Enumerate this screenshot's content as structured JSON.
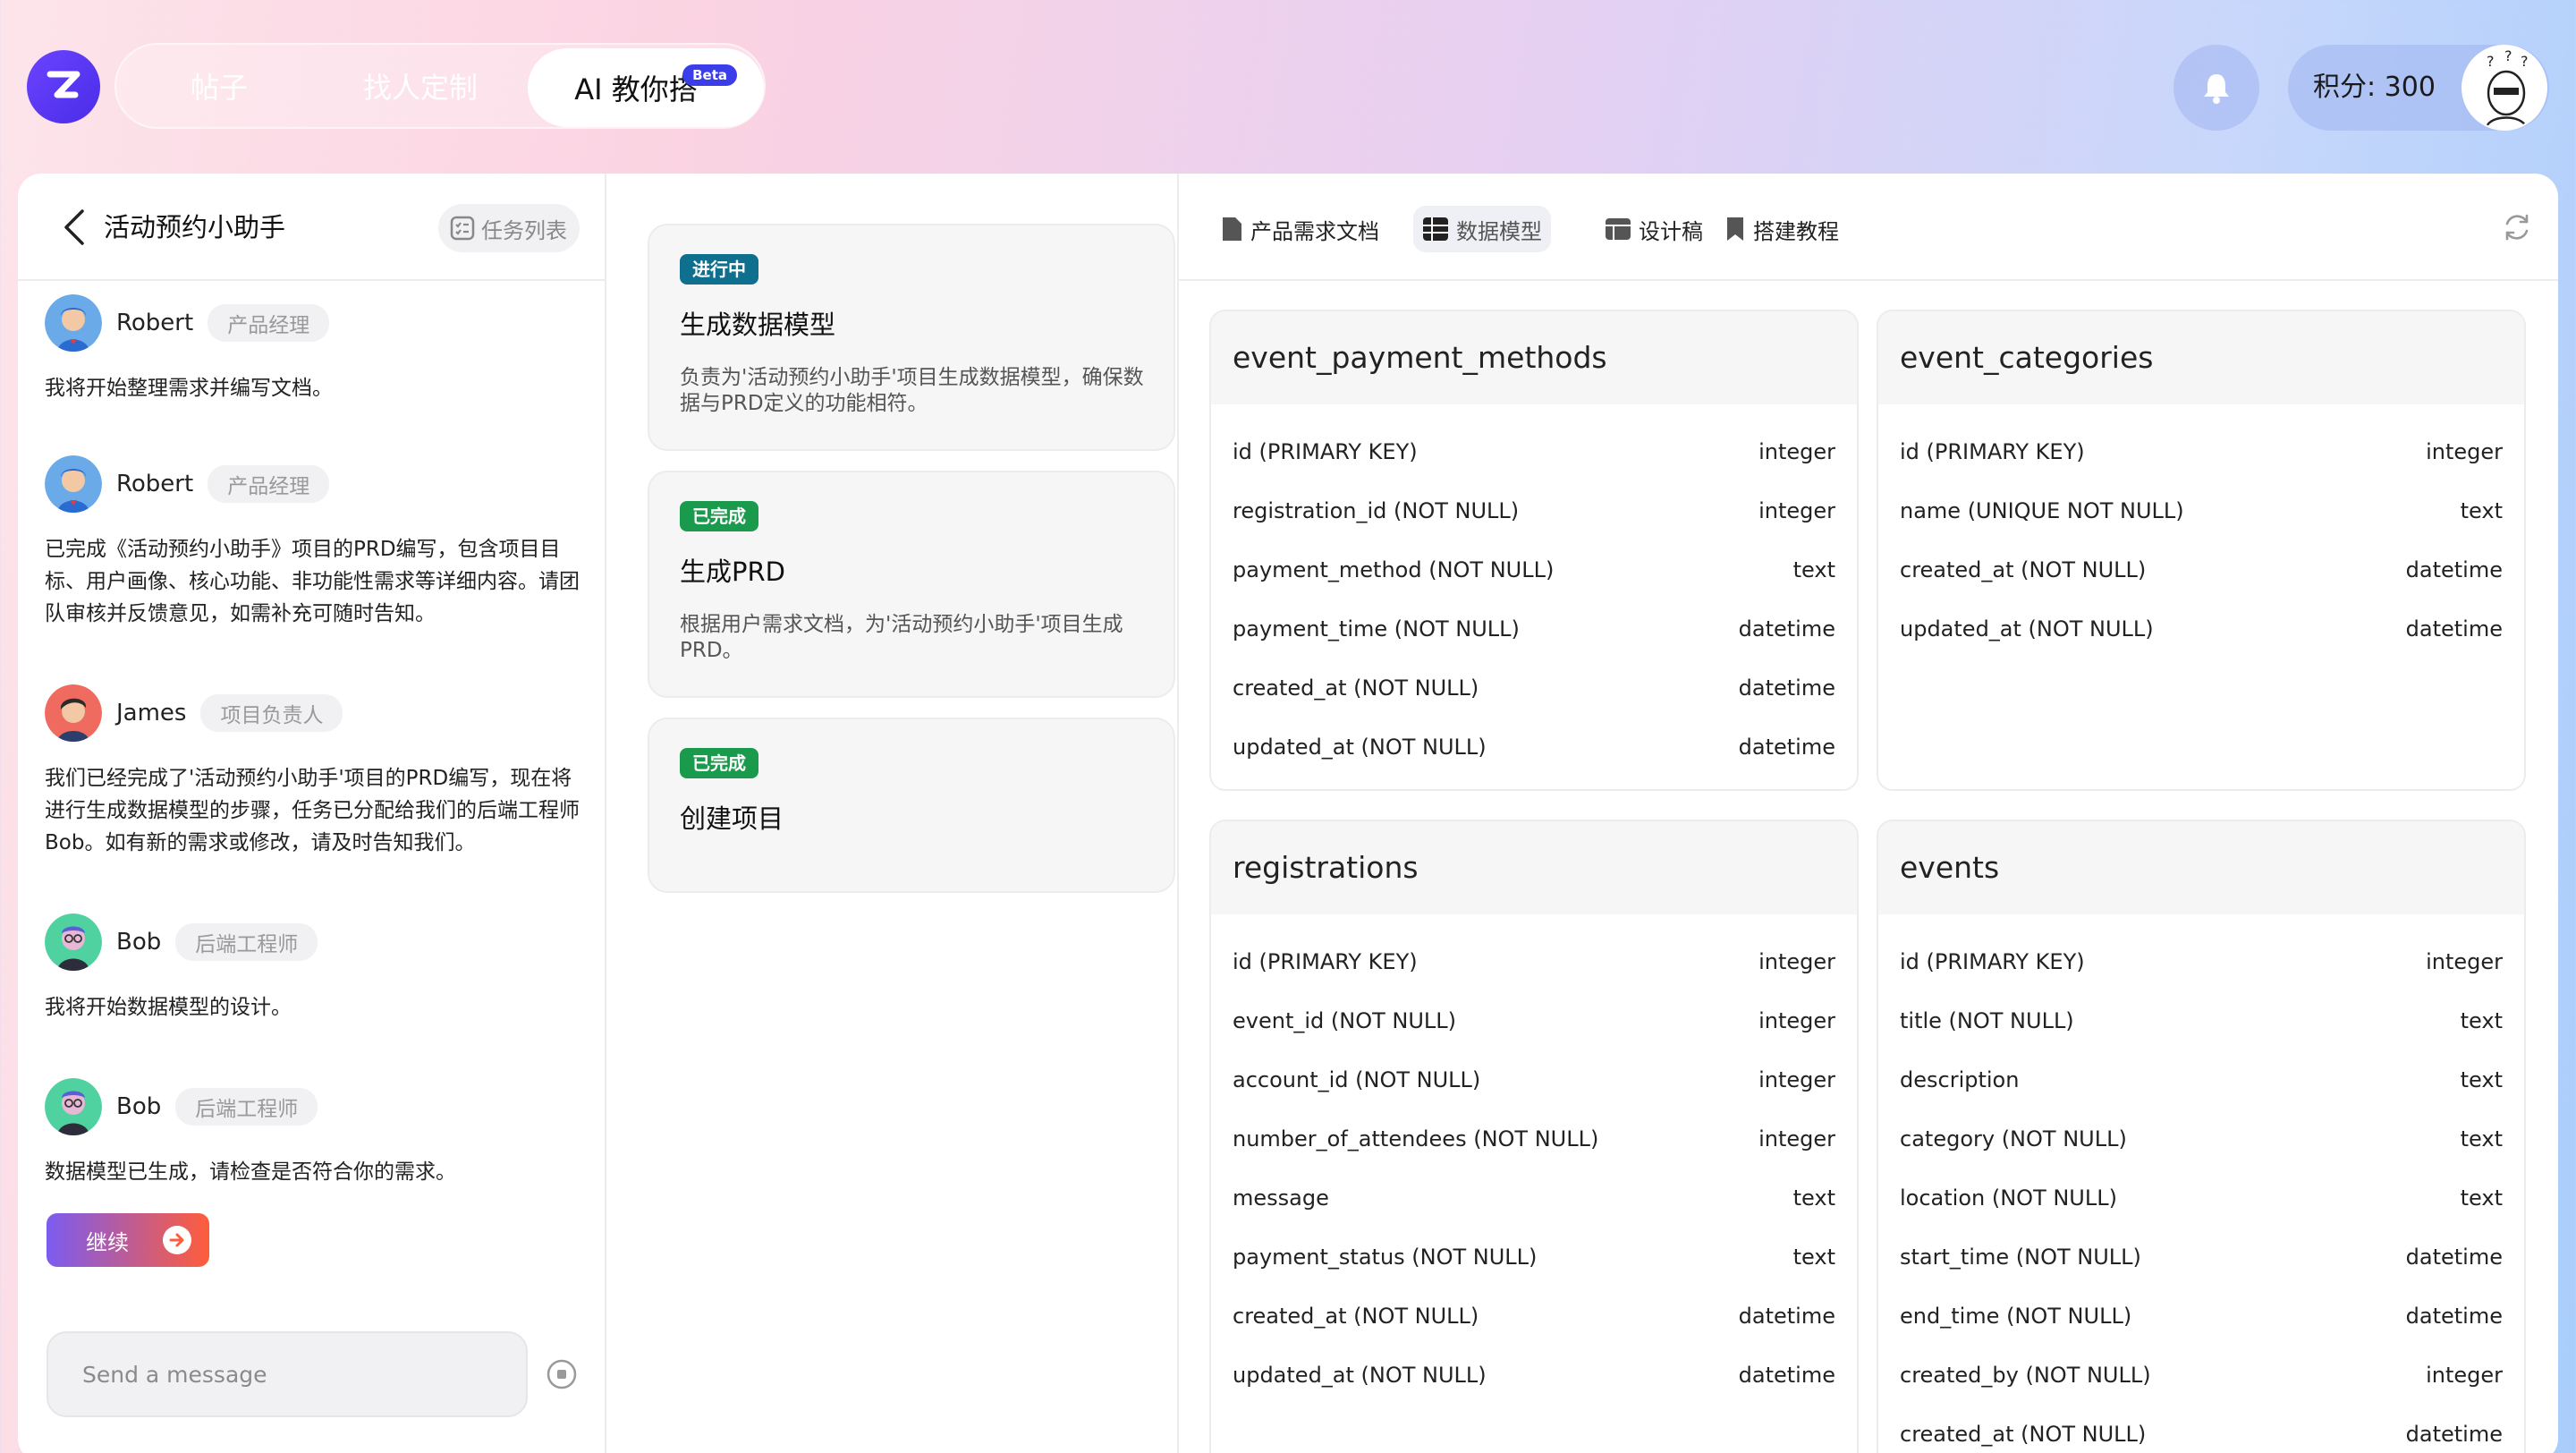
{
  "nav": {
    "tabs": [
      {
        "label": "帖子"
      },
      {
        "label": "找人定制"
      },
      {
        "label": "AI 教你搭"
      }
    ],
    "beta": "Beta"
  },
  "user": {
    "points_label": "积分: 300"
  },
  "chat": {
    "title": "活动预约小助手",
    "task_list_label": "任务列表",
    "messages": [
      {
        "name": "Robert",
        "role": "产品经理",
        "text": "我将开始整理需求并编写文档。"
      },
      {
        "name": "Robert",
        "role": "产品经理",
        "text": "已完成《活动预约小助手》项目的PRD编写，包含项目目标、用户画像、核心功能、非功能性需求等详细内容。请团队审核并反馈意见，如需补充可随时告知。"
      },
      {
        "name": "James",
        "role": "项目负责人",
        "text": "我们已经完成了'活动预约小助手'项目的PRD编写，现在将进行生成数据模型的步骤，任务已分配给我们的后端工程师Bob。如有新的需求或修改，请及时告知我们。"
      },
      {
        "name": "Bob",
        "role": "后端工程师",
        "text": "我将开始数据模型的设计。"
      },
      {
        "name": "Bob",
        "role": "后端工程师",
        "text": "数据模型已生成，请检查是否符合你的需求。"
      }
    ],
    "continue_label": "继续",
    "input_placeholder": "Send a message"
  },
  "tasks": [
    {
      "status": "进行中",
      "title": "生成数据模型",
      "desc": "负责为'活动预约小助手'项目生成数据模型，确保数据与PRD定义的功能相符。"
    },
    {
      "status": "已完成",
      "title": "生成PRD",
      "desc": "根据用户需求文档，为'活动预约小助手'项目生成PRD。"
    },
    {
      "status": "已完成",
      "title": "创建项目",
      "desc": ""
    }
  ],
  "right_tabs": [
    {
      "label": "产品需求文档"
    },
    {
      "label": "数据模型"
    },
    {
      "label": "设计稿"
    },
    {
      "label": "搭建教程"
    }
  ],
  "tables": [
    {
      "name": "event_payment_methods",
      "columns": [
        {
          "field": "id (PRIMARY KEY)",
          "type": "integer"
        },
        {
          "field": "registration_id (NOT NULL)",
          "type": "integer"
        },
        {
          "field": "payment_method (NOT NULL)",
          "type": "text"
        },
        {
          "field": "payment_time (NOT NULL)",
          "type": "datetime"
        },
        {
          "field": "created_at (NOT NULL)",
          "type": "datetime"
        },
        {
          "field": "updated_at (NOT NULL)",
          "type": "datetime"
        }
      ]
    },
    {
      "name": "event_categories",
      "columns": [
        {
          "field": "id (PRIMARY KEY)",
          "type": "integer"
        },
        {
          "field": "name (UNIQUE NOT NULL)",
          "type": "text"
        },
        {
          "field": "created_at (NOT NULL)",
          "type": "datetime"
        },
        {
          "field": "updated_at (NOT NULL)",
          "type": "datetime"
        }
      ]
    },
    {
      "name": "registrations",
      "columns": [
        {
          "field": "id (PRIMARY KEY)",
          "type": "integer"
        },
        {
          "field": "event_id (NOT NULL)",
          "type": "integer"
        },
        {
          "field": "account_id (NOT NULL)",
          "type": "integer"
        },
        {
          "field": "number_of_attendees (NOT NULL)",
          "type": "integer"
        },
        {
          "field": "message",
          "type": "text"
        },
        {
          "field": "payment_status (NOT NULL)",
          "type": "text"
        },
        {
          "field": "created_at (NOT NULL)",
          "type": "datetime"
        },
        {
          "field": "updated_at (NOT NULL)",
          "type": "datetime"
        }
      ]
    },
    {
      "name": "events",
      "columns": [
        {
          "field": "id (PRIMARY KEY)",
          "type": "integer"
        },
        {
          "field": "title (NOT NULL)",
          "type": "text"
        },
        {
          "field": "description",
          "type": "text"
        },
        {
          "field": "category (NOT NULL)",
          "type": "text"
        },
        {
          "field": "location (NOT NULL)",
          "type": "text"
        },
        {
          "field": "start_time (NOT NULL)",
          "type": "datetime"
        },
        {
          "field": "end_time (NOT NULL)",
          "type": "datetime"
        },
        {
          "field": "created_by (NOT NULL)",
          "type": "integer"
        },
        {
          "field": "created_at (NOT NULL)",
          "type": "datetime"
        }
      ]
    }
  ]
}
